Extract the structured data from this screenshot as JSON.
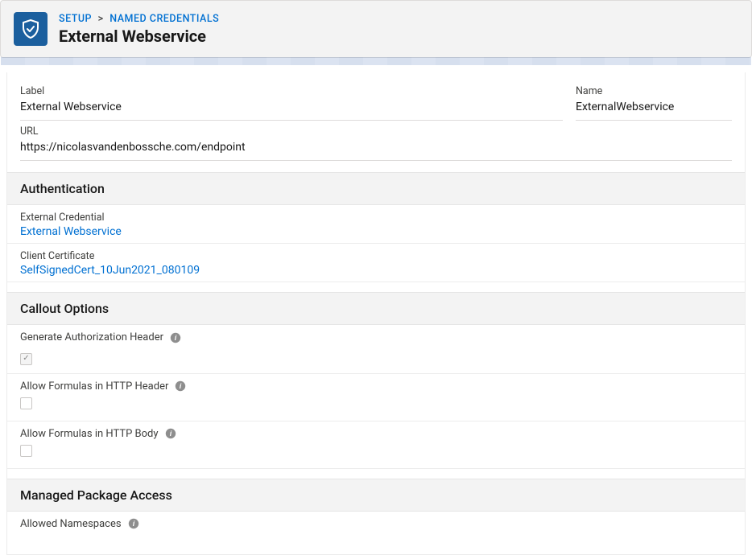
{
  "header": {
    "breadcrumb": {
      "setup": "SETUP",
      "named_credentials": "NAMED CREDENTIALS",
      "separator": ">"
    },
    "title": "External Webservice"
  },
  "basic": {
    "label_label": "Label",
    "label_value": "External Webservice",
    "name_label": "Name",
    "name_value": "ExternalWebservice",
    "url_label": "URL",
    "url_value": "https://nicolasvandenbossche.com/endpoint"
  },
  "authentication": {
    "section_title": "Authentication",
    "external_credential_label": "External Credential",
    "external_credential_value": "External Webservice",
    "client_certificate_label": "Client Certificate",
    "client_certificate_value": "SelfSignedCert_10Jun2021_080109"
  },
  "callout_options": {
    "section_title": "Callout Options",
    "gen_auth_header_label": "Generate Authorization Header",
    "gen_auth_header_checked": true,
    "gen_auth_header_disabled": true,
    "allow_formulas_header_label": "Allow Formulas in HTTP Header",
    "allow_formulas_header_checked": false,
    "allow_formulas_body_label": "Allow Formulas in HTTP Body",
    "allow_formulas_body_checked": false
  },
  "managed_package": {
    "section_title": "Managed Package Access",
    "allowed_namespaces_label": "Allowed Namespaces"
  }
}
